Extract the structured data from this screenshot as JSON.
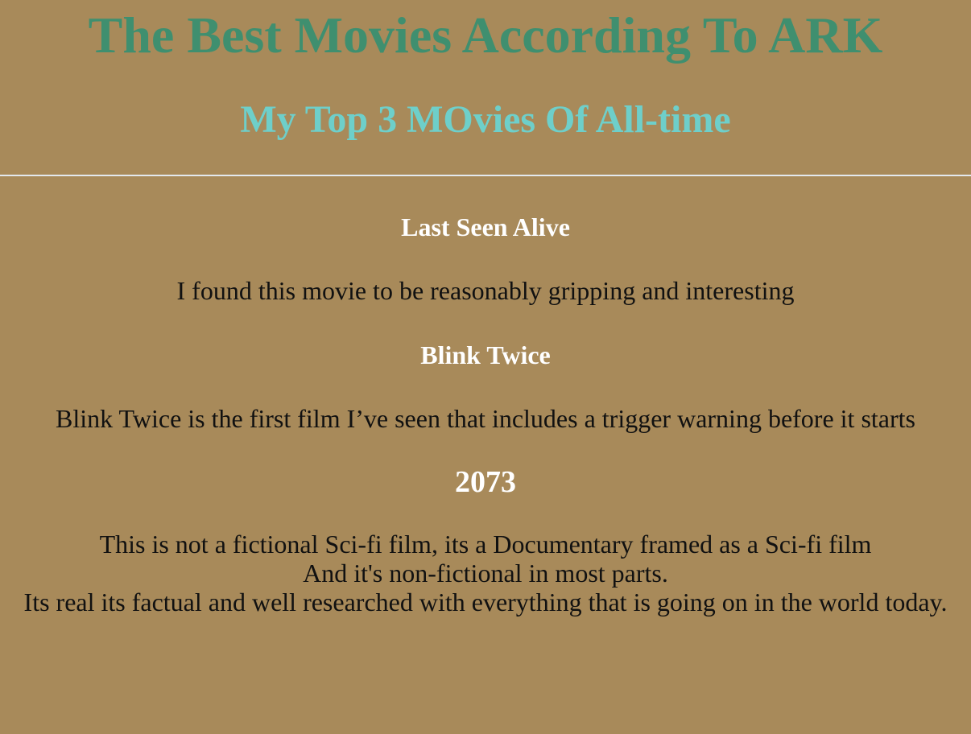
{
  "header": {
    "title": "The Best Movies According To ARK",
    "subtitle": "My Top 3 MOvies Of All-time"
  },
  "movies": [
    {
      "title": "Last Seen Alive",
      "description": "I found this movie to be reasonably gripping and interesting"
    },
    {
      "title": "Blink Twice",
      "description": "Blink Twice is the first film I’ve seen that includes a trigger warning before it starts"
    },
    {
      "title": "2073",
      "description_lines": [
        "This is not a fictional Sci-fi film, its a Documentary framed as a Sci-fi film",
        "And it's non-fictional in most parts.",
        "Its real its factual and well researched with everything that is going on in the world today."
      ]
    }
  ],
  "colors": {
    "background": "#a88a5a",
    "title": "#3f8f6f",
    "subtitle": "#6ecfca",
    "movie_title": "#ffffff",
    "body_text": "#111111"
  }
}
